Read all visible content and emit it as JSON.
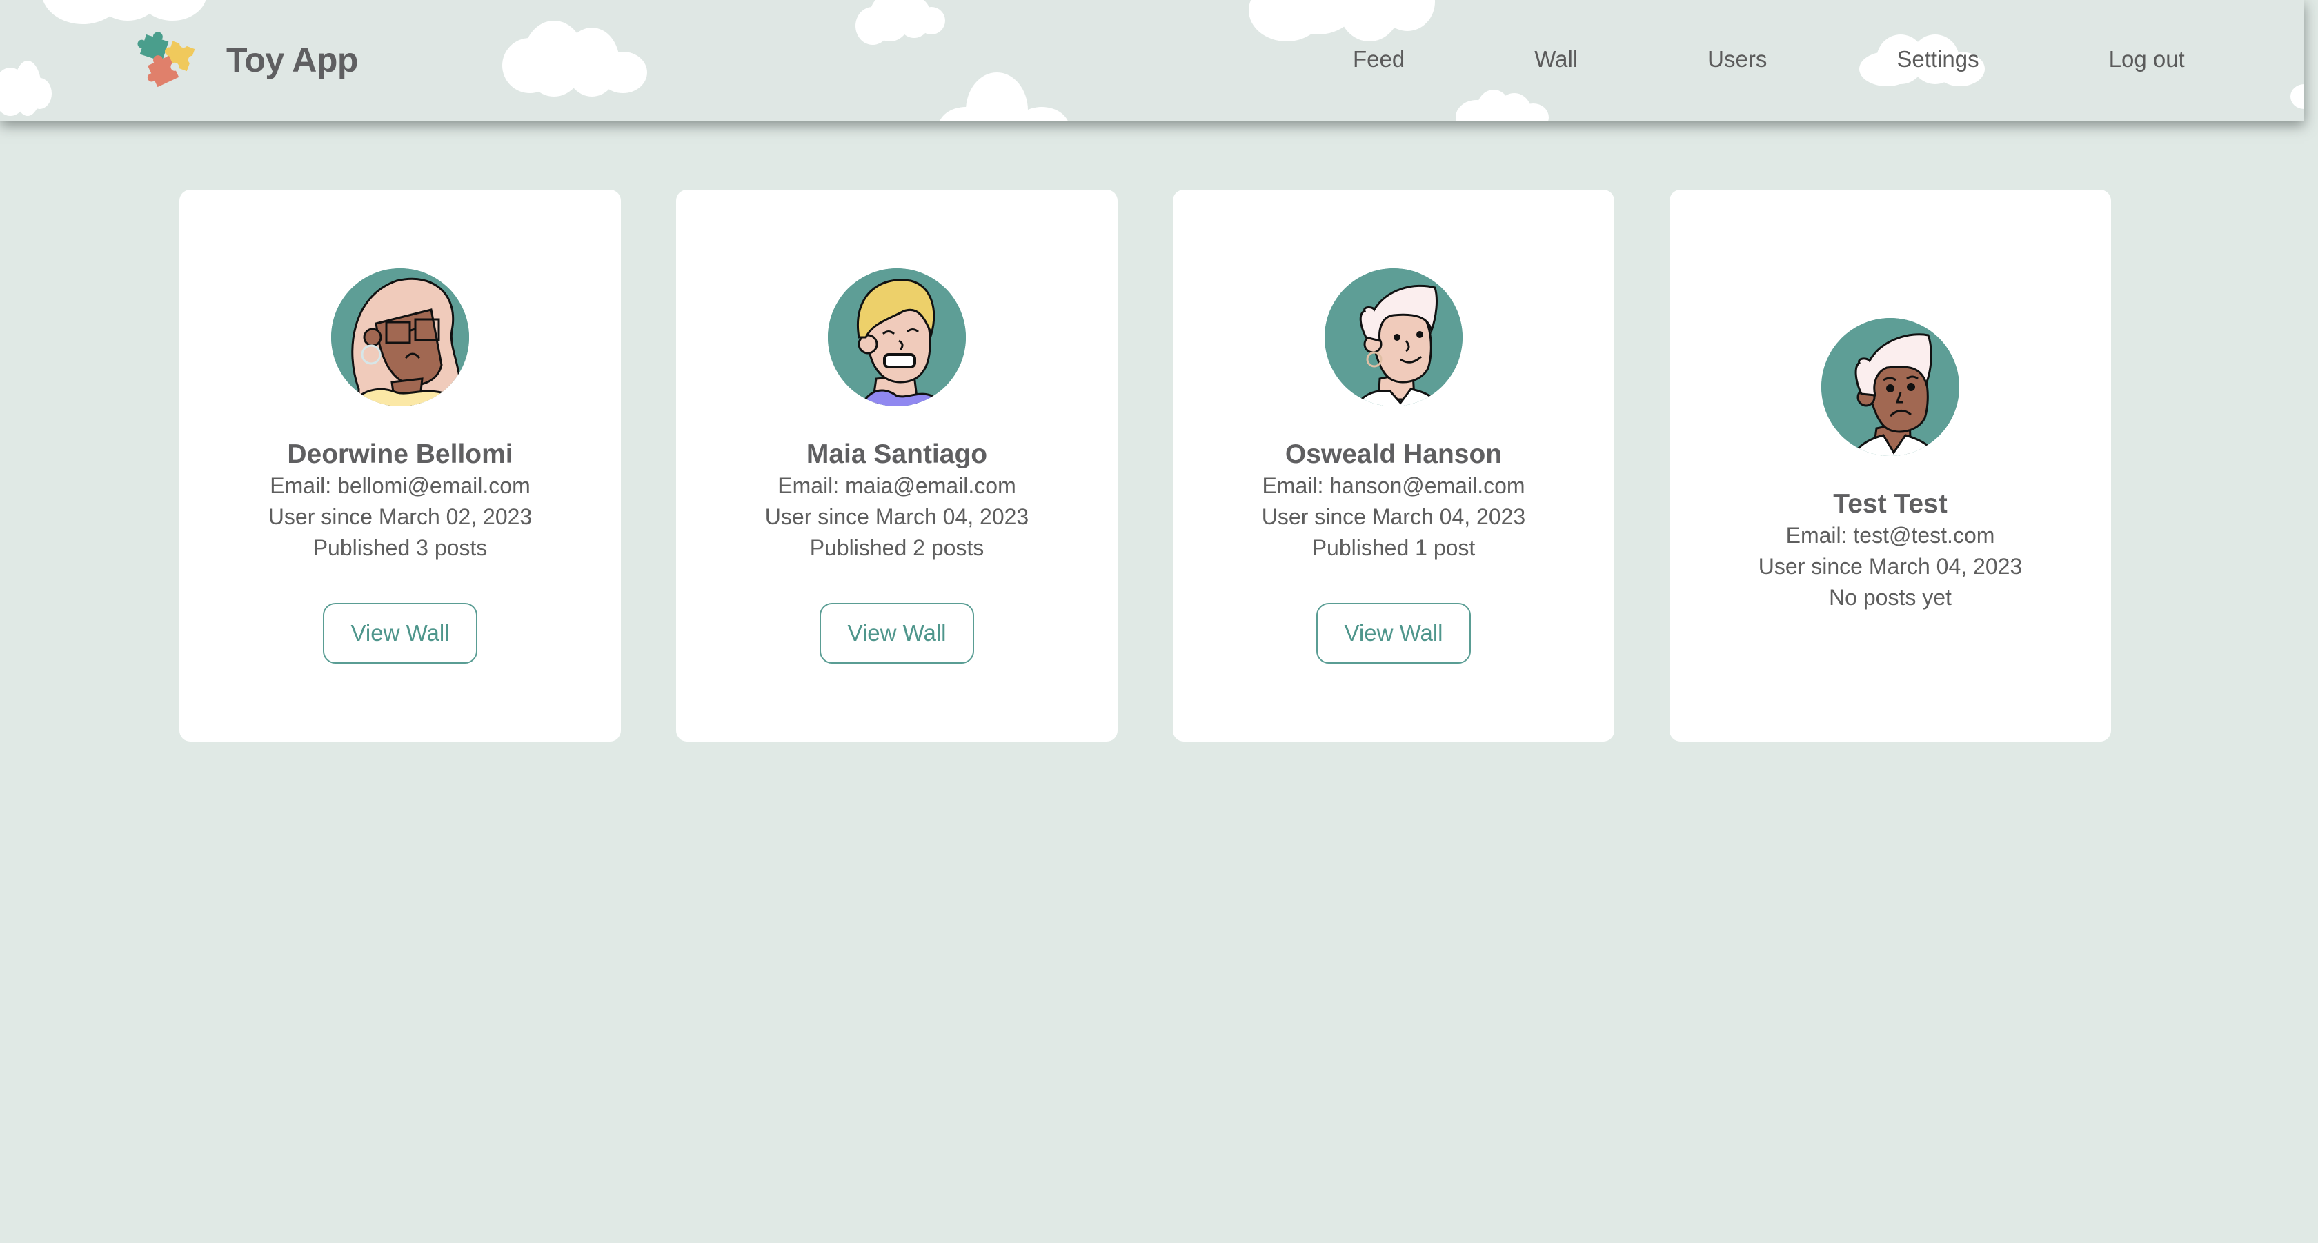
{
  "header": {
    "brand_name": "Toy App",
    "logo_icon": "puzzle-pieces-icon",
    "nav": [
      {
        "label": "Feed"
      },
      {
        "label": "Wall"
      },
      {
        "label": "Users"
      },
      {
        "label": "Settings"
      },
      {
        "label": "Log out"
      }
    ]
  },
  "colors": {
    "background": "#e0e9e5",
    "accent": "#5a9d94",
    "avatar_bg": "#5e9e96",
    "text": "#5e5e5e"
  },
  "users": [
    {
      "name": "Deorwine Bellomi",
      "email": "Email: bellomi@email.com",
      "since": "User since March 02, 2023",
      "posts": "Published 3 posts",
      "button": "View Wall",
      "avatar_icon": "avatar-woman-glasses-icon"
    },
    {
      "name": "Maia Santiago",
      "email": "Email: maia@email.com",
      "since": "User since March 04, 2023",
      "posts": "Published 2 posts",
      "button": "View Wall",
      "avatar_icon": "avatar-blonde-grimace-icon"
    },
    {
      "name": "Osweald Hanson",
      "email": "Email: hanson@email.com",
      "since": "User since March 04, 2023",
      "posts": "Published 1 post",
      "button": "View Wall",
      "avatar_icon": "avatar-white-hair-smile-icon"
    },
    {
      "name": "Test Test",
      "email": "Email: test@test.com",
      "since": "User since March 04, 2023",
      "posts": "No posts yet",
      "avatar_icon": "avatar-white-hair-frown-icon"
    }
  ]
}
